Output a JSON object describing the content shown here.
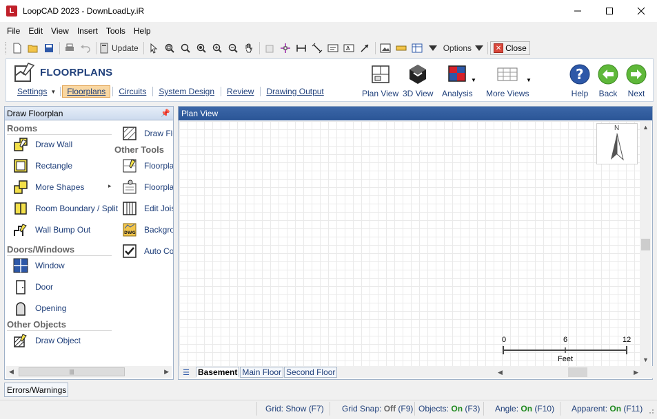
{
  "window": {
    "title": "LoopCAD 2023 - DownLoadLy.iR",
    "app_icon_letter": "L"
  },
  "menu": [
    "File",
    "Edit",
    "View",
    "Insert",
    "Tools",
    "Help"
  ],
  "toolbar": {
    "update_label": "Update",
    "options_label": "Options",
    "close_label": "Close"
  },
  "ribbon": {
    "title": "FLOORPLANS",
    "tabs": [
      "Settings",
      "Floorplans",
      "Circuits",
      "System Design",
      "Review",
      "Drawing Output"
    ],
    "active_tab": "Floorplans",
    "buttons": {
      "plan_view": "Plan View",
      "view_3d": "3D View",
      "analysis": "Analysis",
      "more_views": "More Views",
      "help": "Help",
      "back": "Back",
      "next": "Next"
    }
  },
  "left_panel": {
    "title": "Draw Floorplan",
    "sections": {
      "rooms": "Rooms",
      "doors_windows": "Doors/Windows",
      "other_objects": "Other Objects",
      "other_tools": "Other Tools"
    },
    "tools": {
      "draw_wall": "Draw Wall",
      "rectangle": "Rectangle",
      "more_shapes": "More Shapes",
      "room_boundary": "Room Boundary / Split",
      "wall_bump_out": "Wall Bump Out",
      "window": "Window",
      "door": "Door",
      "opening": "Opening",
      "draw_object": "Draw Object",
      "draw_flo": "Draw Flo",
      "floorplan1": "Floorplan",
      "floorplan2": "Floorplan",
      "edit_joist": "Edit Joist",
      "background": "Backgrou",
      "auto_cor": "Auto Cor"
    }
  },
  "plan_view": {
    "title": "Plan View",
    "north_label": "N",
    "scale": {
      "ticks": [
        "0",
        "6",
        "12"
      ],
      "unit": "Feet"
    },
    "floor_tabs": [
      "Basement",
      "Main Floor",
      "Second Floor"
    ],
    "active_floor": "Basement"
  },
  "errors_tab": "Errors/Warnings",
  "status": {
    "grid": "Grid: Show (F7)",
    "grid_snap_prefix": "Grid Snap:",
    "grid_snap_value": "Off",
    "grid_snap_key": "(F9)",
    "objects_prefix": "Objects:",
    "objects_value": "On",
    "objects_key": "(F3)",
    "angle_prefix": "Angle:",
    "angle_value": "On",
    "angle_key": "(F10)",
    "apparent_prefix": "Apparent:",
    "apparent_value": "On",
    "apparent_key": "(F11)"
  }
}
